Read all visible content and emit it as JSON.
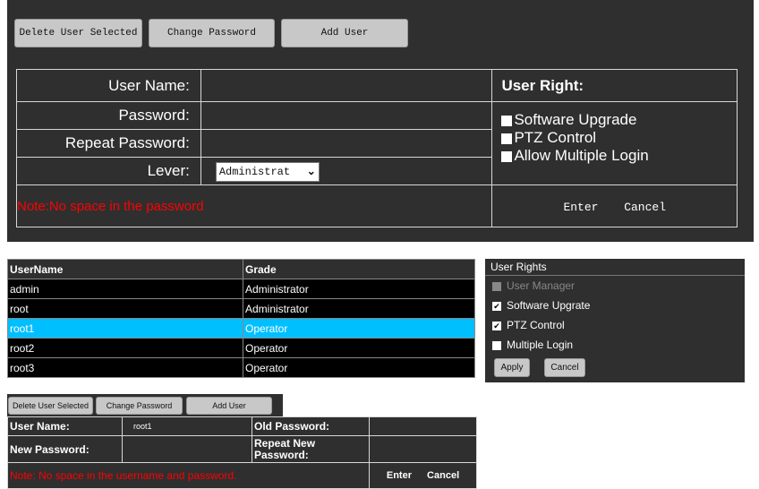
{
  "top": {
    "toolbar": {
      "delete_label": "Delete User Selected",
      "change_label": "Change Password",
      "add_label": "Add User"
    },
    "form": {
      "username_label": "User Name:",
      "password_label": "Password:",
      "repeat_label": "Repeat Password:",
      "lever_label": "Lever:",
      "lever_value": "Administrat",
      "note": "Note:No space in the password",
      "enter_label": "Enter",
      "cancel_label": "Cancel"
    },
    "rights": {
      "title": "User Right:",
      "items": [
        "Software Upgrade",
        "PTZ Control",
        "Allow Multiple Login"
      ]
    }
  },
  "bottom": {
    "table": {
      "headers": [
        "UserName",
        "Grade"
      ],
      "rows": [
        {
          "name": "admin",
          "grade": "Administrator"
        },
        {
          "name": "root",
          "grade": "Administrator"
        },
        {
          "name": "root1",
          "grade": "Operator"
        },
        {
          "name": "root2",
          "grade": "Operator"
        },
        {
          "name": "root3",
          "grade": "Operator"
        }
      ]
    },
    "rights": {
      "title": "User Rights",
      "items": [
        {
          "label": "User Manager",
          "checked": false,
          "disabled": true
        },
        {
          "label": "Software Upgrate",
          "checked": true,
          "disabled": false
        },
        {
          "label": "PTZ Control",
          "checked": true,
          "disabled": false
        },
        {
          "label": "Multiple Login",
          "checked": false,
          "disabled": false
        }
      ],
      "apply_label": "Apply",
      "cancel_label": "Cancel"
    },
    "toolbar": {
      "delete_label": "Delete User Selected",
      "change_label": "Change Password",
      "add_label": "Add User"
    },
    "form": {
      "username_label": "User Name:",
      "username_value": "root1",
      "old_password_label": "Old Password:",
      "new_password_label": "New Password:",
      "repeat_label": "Repeat New Password:",
      "note": "Note: No space in the username and password.",
      "enter_label": "Enter",
      "cancel_label": "Cancel"
    }
  },
  "colors": {
    "panel": "#2f2f2f",
    "selected": "#00bfff",
    "note": "#ff0000"
  }
}
